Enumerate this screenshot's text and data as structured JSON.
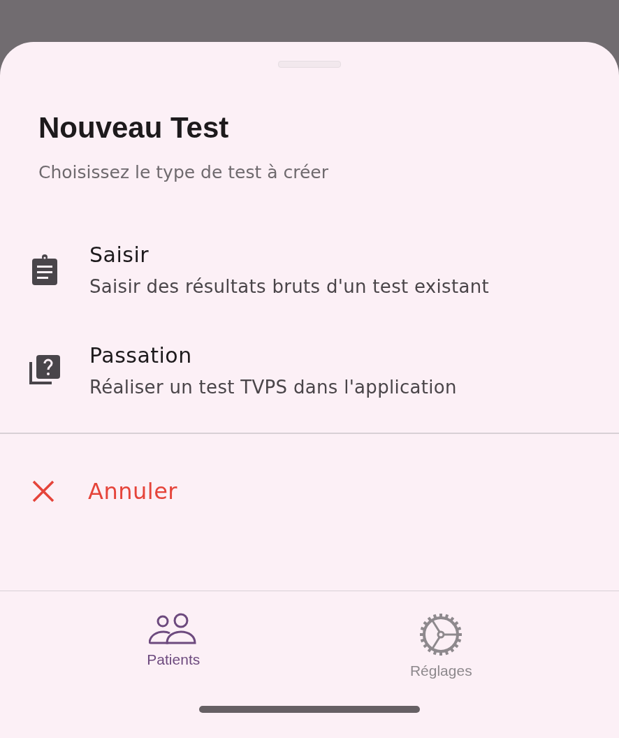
{
  "sheet": {
    "title": "Nouveau Test",
    "subtitle": "Choisissez le type de test à créer",
    "options": [
      {
        "kind": "clipboard",
        "title": "Saisir",
        "description": "Saisir des résultats bruts d'un test existant"
      },
      {
        "kind": "quiz",
        "title": "Passation",
        "description": "Réaliser un test TVPS dans l'application"
      }
    ],
    "cancel": "Annuler"
  },
  "tabs": [
    {
      "kind": "people",
      "label": "Patients",
      "selected": true
    },
    {
      "kind": "settings",
      "label": "Réglages",
      "selected": false
    }
  ]
}
